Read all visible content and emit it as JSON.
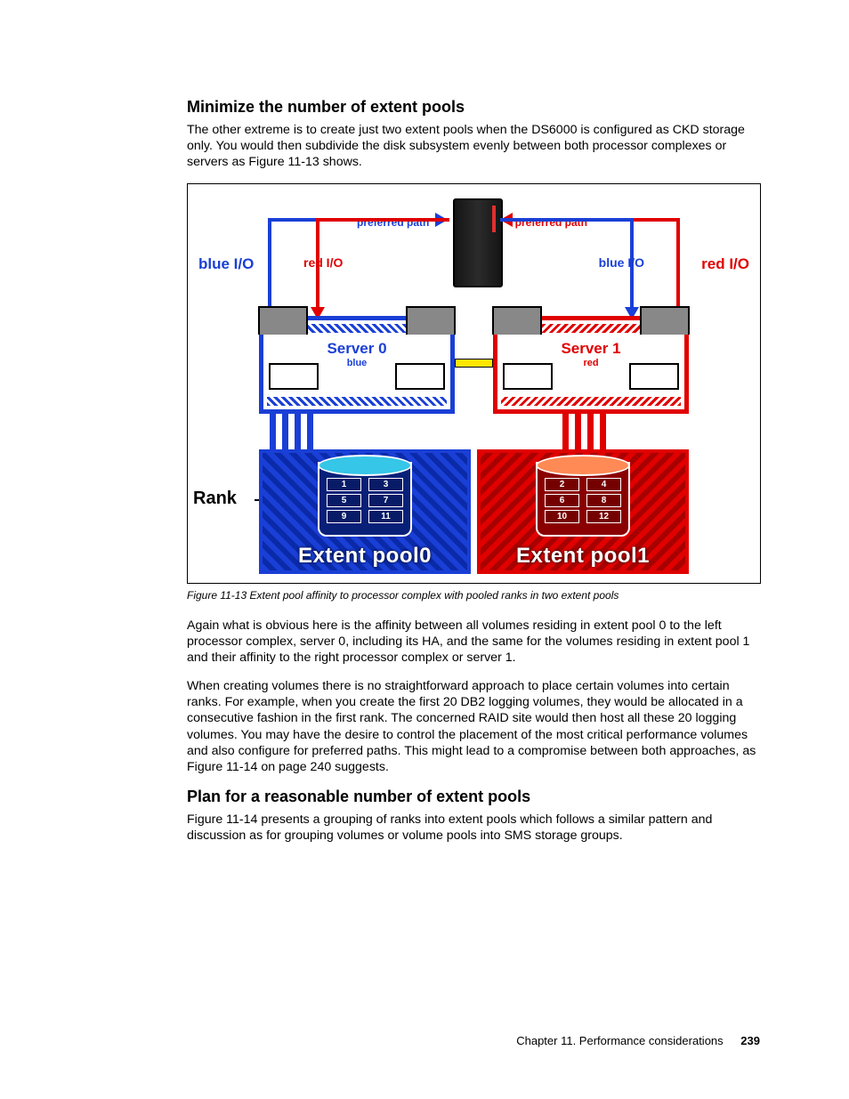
{
  "headings": {
    "h1": "Minimize the number of extent pools",
    "h2": "Plan for a reasonable number of extent pools"
  },
  "paragraphs": {
    "p1": "The other extreme is to create just two extent pools when the DS6000 is configured as CKD storage only. You would then subdivide the disk subsystem evenly between both processor complexes or servers as Figure 11-13 shows.",
    "p2": "Again what is obvious here is the affinity between all volumes residing in extent pool 0 to the left processor complex, server 0, including its HA, and the same for the volumes residing in extent pool 1 and their affinity to the right processor complex or server 1.",
    "p3": "When creating volumes there is no straightforward approach to place certain volumes into certain ranks. For example, when you create the first 20 DB2 logging volumes, they would be allocated in a consecutive fashion in the first rank. The concerned RAID site would then host all these 20 logging volumes. You may have the desire to control the placement of the most critical performance volumes and also configure for preferred paths. This might lead to a compromise between both approaches, as Figure 11-14 on page 240 suggests.",
    "p4": "Figure 11-14 presents a grouping of ranks into extent pools which follows a similar pattern and discussion as for grouping volumes or volume pools into SMS storage groups."
  },
  "caption": "Figure 11-13   Extent pool affinity to processor complex with pooled ranks in two extent pools",
  "figure": {
    "labels": {
      "preferred_left": "preferred path",
      "preferred_right": "preferred path",
      "io_blue": "blue I/O",
      "io_red": "red I/O",
      "server0": "Server 0",
      "server0_sub": "blue",
      "server1": "Server 1",
      "server1_sub": "red",
      "rank": "Rank",
      "pool0": "Extent pool0",
      "pool1": "Extent pool1"
    },
    "ranks_left": [
      "1",
      "3",
      "5",
      "7",
      "9",
      "11"
    ],
    "ranks_right": [
      "2",
      "4",
      "6",
      "8",
      "10",
      "12"
    ]
  },
  "footer": {
    "chapter": "Chapter 11. Performance considerations",
    "page": "239"
  },
  "chart_data": {
    "type": "table",
    "title": "Extent pool affinity to processor complex with pooled ranks in two extent pools",
    "series": [
      {
        "name": "Extent pool0 (Server 0, blue, preferred path left)",
        "values": [
          1,
          3,
          5,
          7,
          9,
          11
        ]
      },
      {
        "name": "Extent pool1 (Server 1, red, preferred path right)",
        "values": [
          2,
          4,
          6,
          8,
          10,
          12
        ]
      }
    ]
  }
}
